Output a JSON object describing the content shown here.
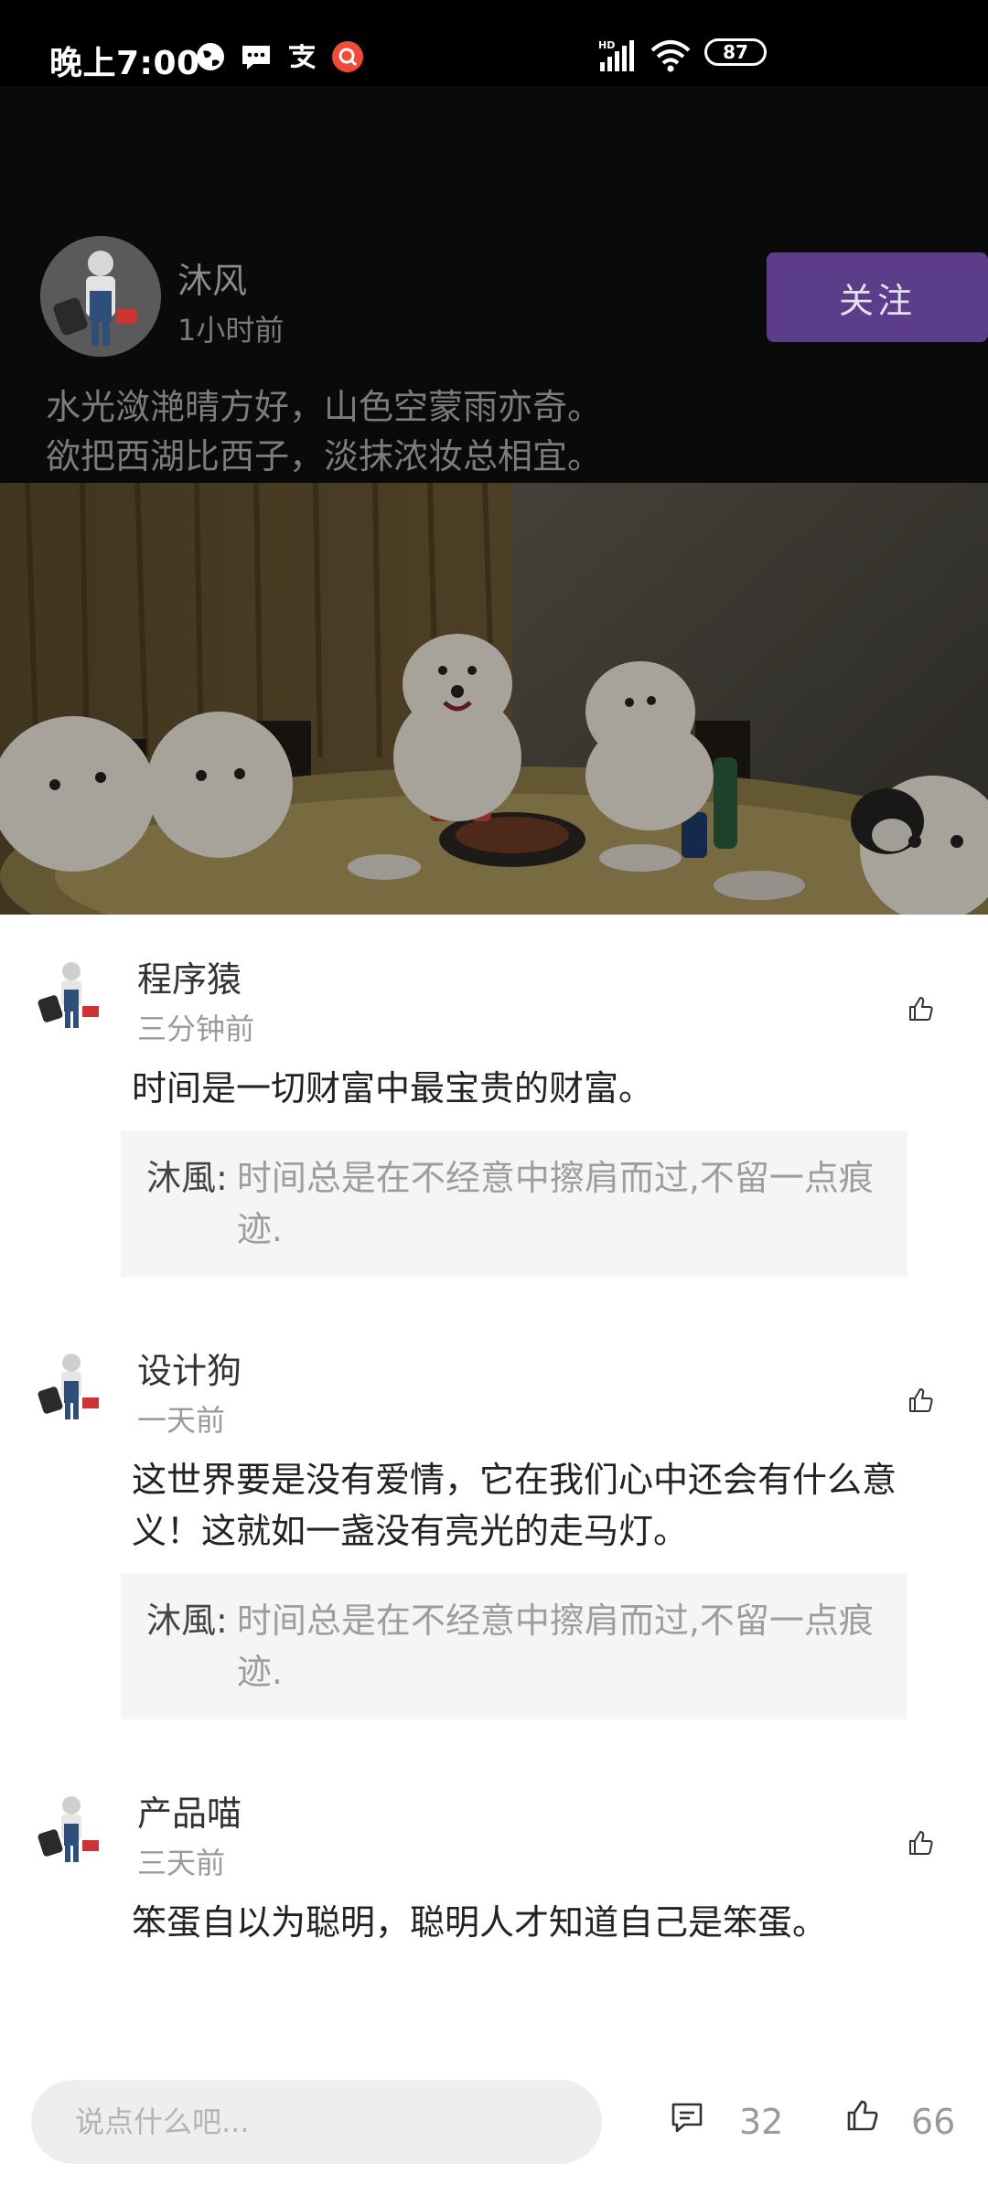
{
  "status_bar": {
    "time": "晚上7:00",
    "battery": "87",
    "network_label": "HD"
  },
  "post": {
    "author": "沐风",
    "time": "1小时前",
    "follow_label": "关注",
    "text_lines": [
      "水光潋滟晴方好，山色空蒙雨亦奇。",
      "欲把西湖比西子，淡抹浓妆总相宜。"
    ]
  },
  "comments": [
    {
      "name": "程序猿",
      "time": "三分钟前",
      "text": "时间是一切财富中最宝贵的财富。",
      "reply": {
        "name": "沐風:",
        "text": "时间总是在不经意中擦肩而过,不留一点痕迹."
      }
    },
    {
      "name": "设计狗",
      "time": "一天前",
      "text": "这世界要是没有爱情，它在我们心中还会有什么意义！这就如一盏没有亮光的走马灯。",
      "reply": {
        "name": "沐風:",
        "text": "时间总是在不经意中擦肩而过,不留一点痕迹."
      }
    },
    {
      "name": "产品喵",
      "time": "三天前",
      "text": "笨蛋自以为聪明，聪明人才知道自己是笨蛋。"
    }
  ],
  "bottom_bar": {
    "input_placeholder": "说点什么吧...",
    "comment_count": "32",
    "like_count": "66"
  },
  "colors": {
    "follow_button": "#5b3d8a",
    "header_bg": "#0a0a0a",
    "reply_bg": "#f5f5f5"
  }
}
